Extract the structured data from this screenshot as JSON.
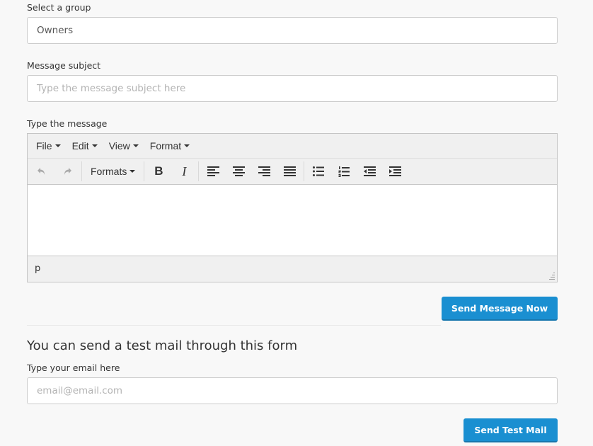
{
  "group": {
    "label": "Select a group",
    "value": "Owners"
  },
  "subject": {
    "label": "Message subject",
    "placeholder": "Type the message subject here"
  },
  "message": {
    "label": "Type the message",
    "menubar": [
      {
        "label": "File"
      },
      {
        "label": "Edit"
      },
      {
        "label": "View"
      },
      {
        "label": "Format"
      }
    ],
    "toolbar": {
      "undo_icon": "undo-icon",
      "redo_icon": "redo-icon",
      "formats_label": "Formats",
      "bold_label": "B",
      "italic_label": "I",
      "icons": [
        "align-left-icon",
        "align-center-icon",
        "align-right-icon",
        "align-justify-icon",
        "bullet-list-icon",
        "numbered-list-icon",
        "outdent-icon",
        "indent-icon"
      ]
    },
    "status_path": "p"
  },
  "send_button": {
    "label": "Send Message Now",
    "color": "#1a8fd1"
  },
  "test": {
    "heading": "You can send a test mail through this form",
    "email_label": "Type your email here",
    "email_placeholder": "email@email.com",
    "button_label": "Send Test Mail"
  }
}
